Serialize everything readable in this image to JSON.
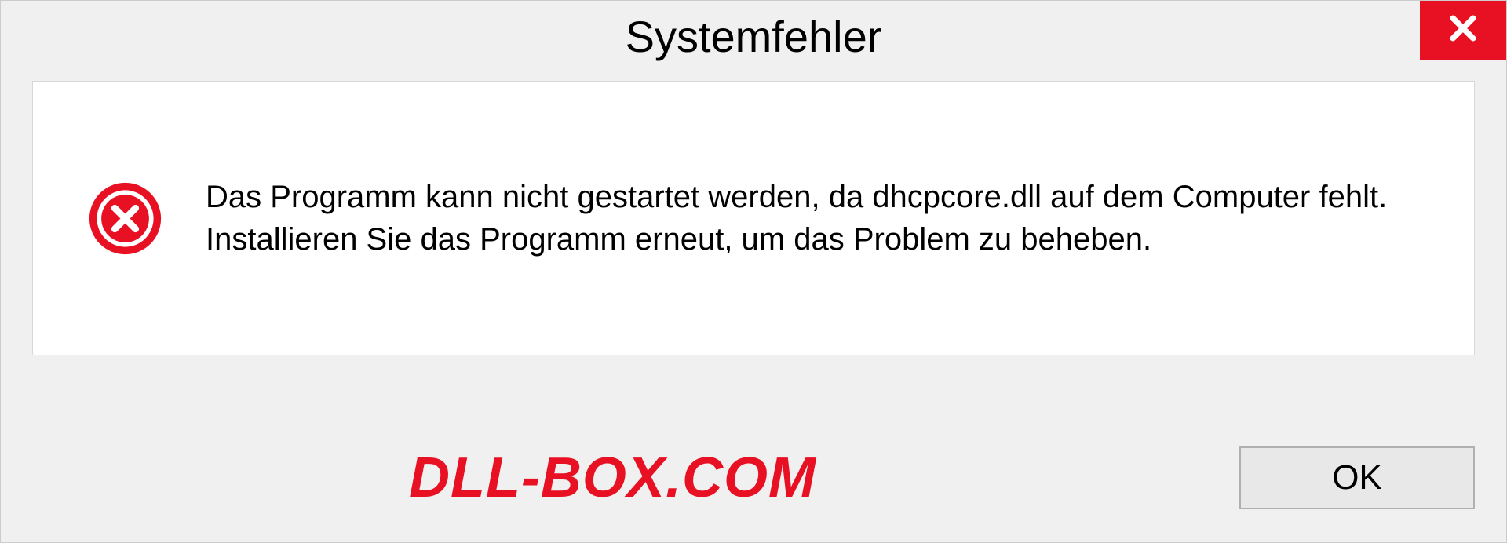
{
  "dialog": {
    "title": "Systemfehler",
    "message": "Das Programm kann nicht gestartet werden, da dhcpcore.dll auf dem Computer fehlt. Installieren Sie das Programm erneut, um das Problem zu beheben.",
    "ok_label": "OK",
    "watermark": "DLL-BOX.COM"
  }
}
